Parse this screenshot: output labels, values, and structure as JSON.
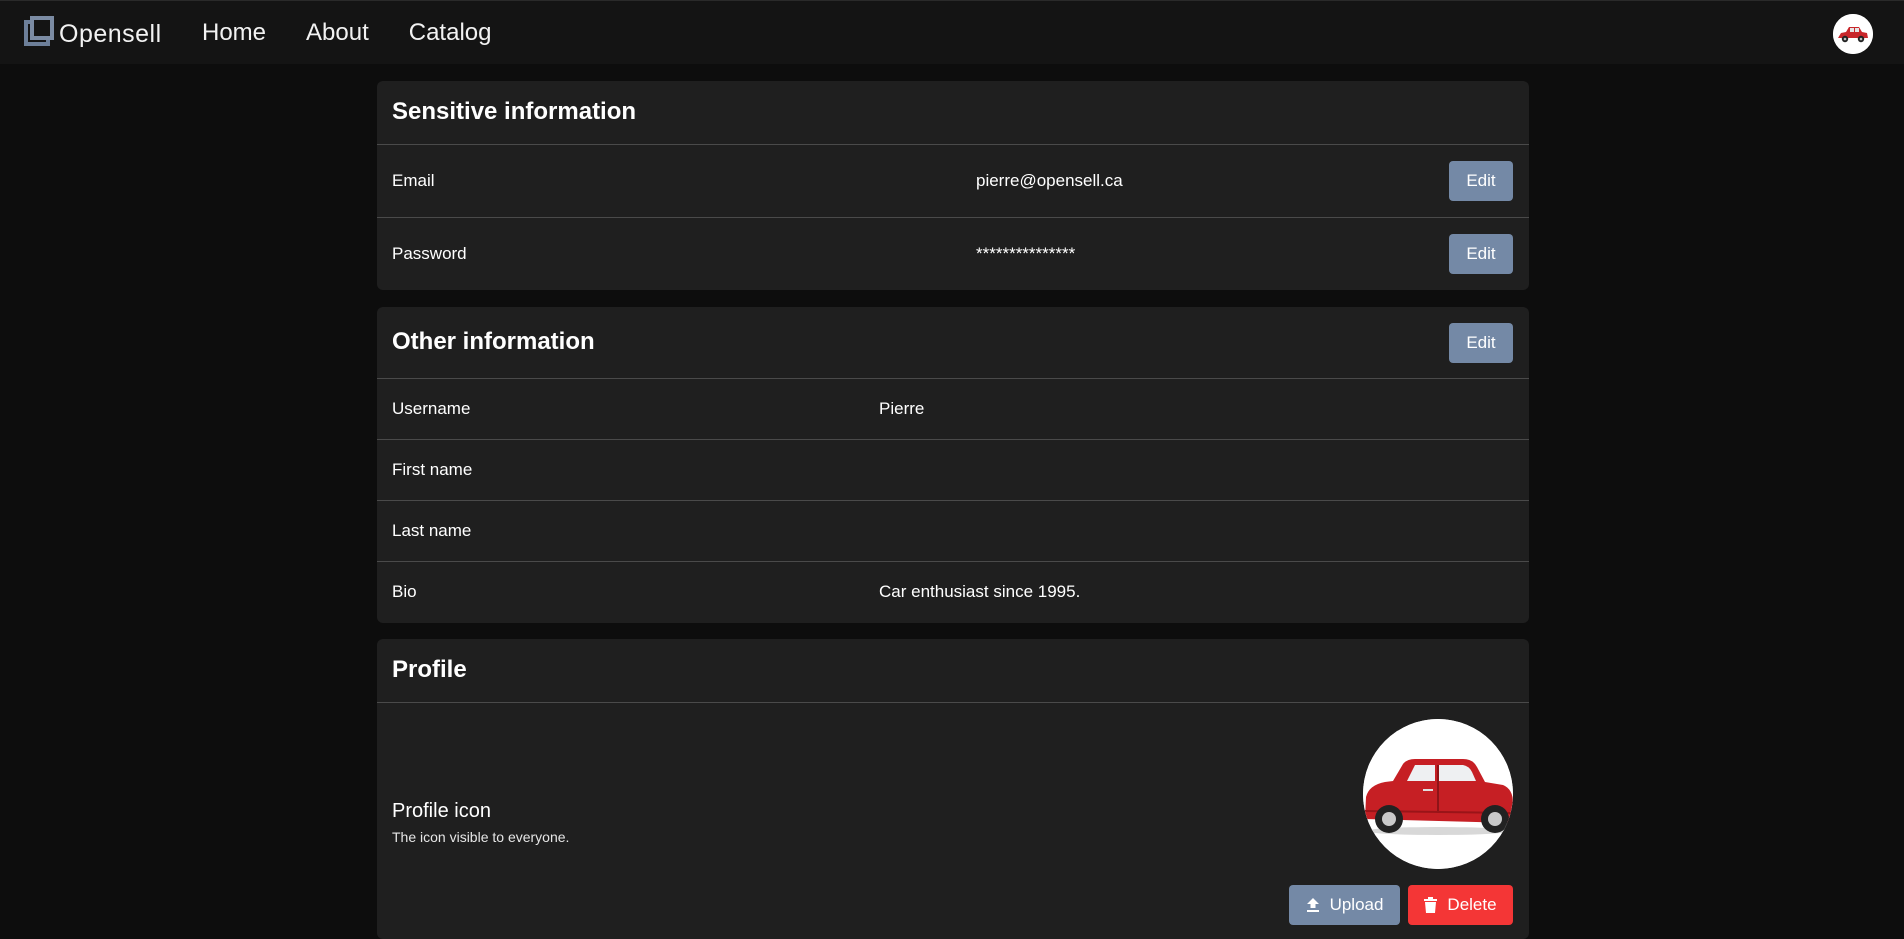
{
  "nav": {
    "brand": "Opensell",
    "links": [
      "Home",
      "About",
      "Catalog"
    ]
  },
  "sensitive": {
    "title": "Sensitive information",
    "rows": [
      {
        "label": "Email",
        "value": "pierre@opensell.ca",
        "button": "Edit"
      },
      {
        "label": "Password",
        "value": "***************",
        "button": "Edit"
      }
    ]
  },
  "other": {
    "title": "Other information",
    "button": "Edit",
    "rows": [
      {
        "label": "Username",
        "value": "Pierre"
      },
      {
        "label": "First name",
        "value": ""
      },
      {
        "label": "Last name",
        "value": ""
      },
      {
        "label": "Bio",
        "value": "Car enthusiast since 1995."
      }
    ]
  },
  "profile": {
    "title": "Profile",
    "icon_label": "Profile icon",
    "icon_description": "The icon visible to everyone.",
    "upload_label": "Upload",
    "delete_label": "Delete"
  },
  "colors": {
    "primary_button": "#7489a6",
    "danger_button": "#f43636",
    "card_bg": "#1f1f1f",
    "page_bg": "#0d0d0d"
  }
}
